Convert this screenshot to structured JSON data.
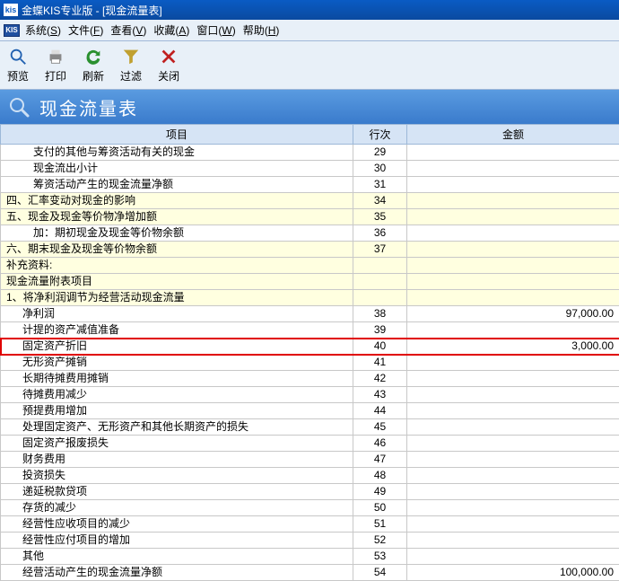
{
  "titlebar": {
    "icon": "kis",
    "text": "金蝶KIS专业版 - [现金流量表]"
  },
  "menubar": {
    "app_icon": "KIS",
    "items": [
      {
        "label": "系统",
        "accel": "S"
      },
      {
        "label": "文件",
        "accel": "F"
      },
      {
        "label": "查看",
        "accel": "V"
      },
      {
        "label": "收藏",
        "accel": "A"
      },
      {
        "label": "窗口",
        "accel": "W"
      },
      {
        "label": "帮助",
        "accel": "H"
      }
    ]
  },
  "toolbar": {
    "items": [
      {
        "name": "preview",
        "label": "预览"
      },
      {
        "name": "print",
        "label": "打印"
      },
      {
        "name": "refresh",
        "label": "刷新"
      },
      {
        "name": "filter",
        "label": "过滤"
      },
      {
        "name": "close",
        "label": "关闭"
      }
    ]
  },
  "page_title": "现金流量表",
  "columns": {
    "item": "项目",
    "line": "行次",
    "amount": "金额"
  },
  "rows": [
    {
      "item": "支付的其他与筹资活动有关的现金",
      "indent": 2,
      "line": "29",
      "amount": ""
    },
    {
      "item": "现金流出小计",
      "indent": 2,
      "line": "30",
      "amount": ""
    },
    {
      "item": "筹资活动产生的现金流量净额",
      "indent": 2,
      "line": "31",
      "amount": ""
    },
    {
      "item": "四、汇率变动对现金的影响",
      "indent": 0,
      "line": "34",
      "amount": "",
      "section": true
    },
    {
      "item": "五、现金及现金等价物净增加额",
      "indent": 0,
      "line": "35",
      "amount": "",
      "section": true
    },
    {
      "item": "加：期初现金及现金等价物余额",
      "indent": 2,
      "line": "36",
      "amount": ""
    },
    {
      "item": "六、期末现金及现金等价物余额",
      "indent": 0,
      "line": "37",
      "amount": "",
      "section": true
    },
    {
      "item": "补充资料:",
      "indent": 0,
      "line": "",
      "amount": "",
      "section": true
    },
    {
      "item": "现金流量附表项目",
      "indent": 0,
      "line": "",
      "amount": "",
      "section": true
    },
    {
      "item": "1、将净利润调节为经营活动现金流量",
      "indent": 0,
      "line": "",
      "amount": "",
      "section": true
    },
    {
      "item": "净利润",
      "indent": 1,
      "line": "38",
      "amount": "97,000.00"
    },
    {
      "item": "计提的资产减值准备",
      "indent": 1,
      "line": "39",
      "amount": ""
    },
    {
      "item": "固定资产折旧",
      "indent": 1,
      "line": "40",
      "amount": "3,000.00",
      "highlight": true
    },
    {
      "item": "无形资产摊销",
      "indent": 1,
      "line": "41",
      "amount": ""
    },
    {
      "item": "长期待摊费用摊销",
      "indent": 1,
      "line": "42",
      "amount": ""
    },
    {
      "item": "待摊费用减少",
      "indent": 1,
      "line": "43",
      "amount": ""
    },
    {
      "item": "预提费用增加",
      "indent": 1,
      "line": "44",
      "amount": ""
    },
    {
      "item": "处理固定资产、无形资产和其他长期资产的损失",
      "indent": 1,
      "line": "45",
      "amount": ""
    },
    {
      "item": "固定资产报废损失",
      "indent": 1,
      "line": "46",
      "amount": ""
    },
    {
      "item": "财务费用",
      "indent": 1,
      "line": "47",
      "amount": ""
    },
    {
      "item": "投资损失",
      "indent": 1,
      "line": "48",
      "amount": ""
    },
    {
      "item": "递延税款贷项",
      "indent": 1,
      "line": "49",
      "amount": ""
    },
    {
      "item": "存货的减少",
      "indent": 1,
      "line": "50",
      "amount": ""
    },
    {
      "item": "经营性应收项目的减少",
      "indent": 1,
      "line": "51",
      "amount": ""
    },
    {
      "item": "经营性应付项目的增加",
      "indent": 1,
      "line": "52",
      "amount": ""
    },
    {
      "item": "其他",
      "indent": 1,
      "line": "53",
      "amount": ""
    },
    {
      "item": "经营活动产生的现金流量净额",
      "indent": 1,
      "line": "54",
      "amount": "100,000.00"
    }
  ]
}
